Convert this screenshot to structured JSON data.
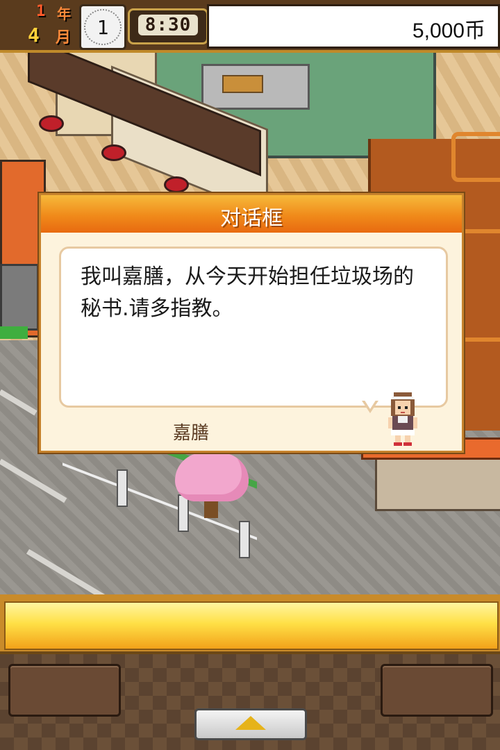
{
  "hud": {
    "year_value": "1",
    "year_unit": "年",
    "month_value": "4",
    "month_unit": "月",
    "week": "1",
    "time": "8:30",
    "money": "5,000币"
  },
  "dialog": {
    "title": "对话框",
    "message": "我叫嘉膳，从今天开始担任垃圾场的秘书.请多指教。",
    "speaker": "嘉膳"
  },
  "icons": {
    "up_button": "up-arrow-icon",
    "portrait": "secretary-portrait"
  },
  "colors": {
    "title_bar": "#f08a1a",
    "bottom_bar": "#ffe046",
    "hud_bg": "#5a3b1d"
  }
}
